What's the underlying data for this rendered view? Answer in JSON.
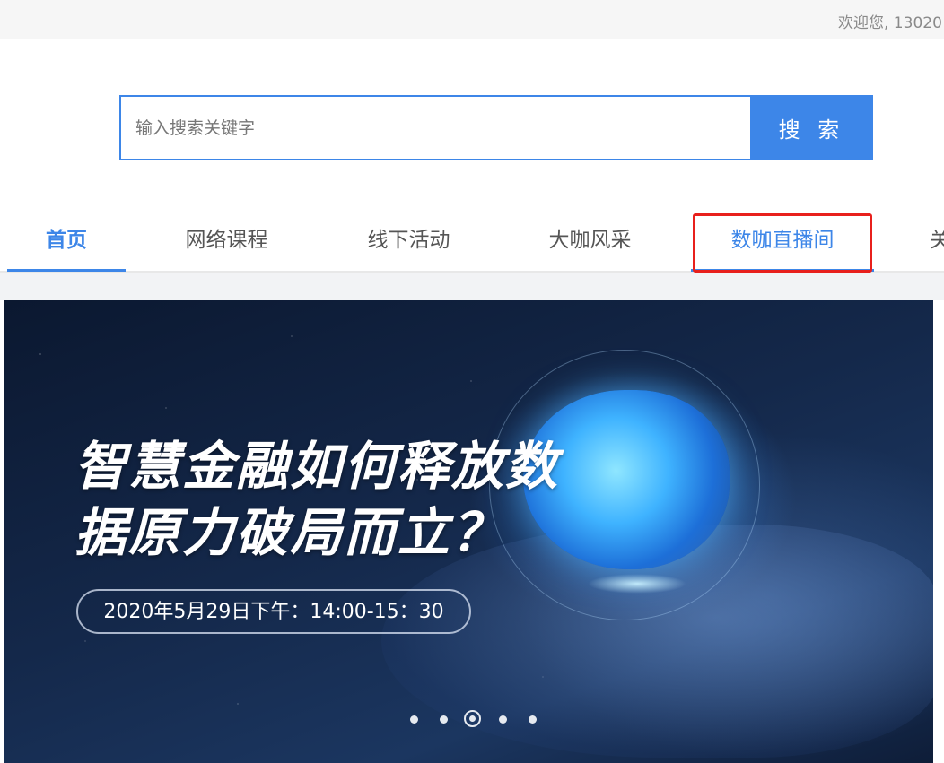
{
  "topbar": {
    "welcome": "欢迎您, 13020"
  },
  "search": {
    "placeholder": "输入搜索关键字",
    "value": "",
    "button_label": "搜 索"
  },
  "nav": {
    "items": [
      {
        "label": "首页"
      },
      {
        "label": "网络课程"
      },
      {
        "label": "线下活动"
      },
      {
        "label": "大咖风采"
      },
      {
        "label": "数咖直播间"
      },
      {
        "label": "关"
      }
    ]
  },
  "colors": {
    "accent": "#3d86e8",
    "highlight_border": "#e8201c"
  },
  "banner": {
    "headline_line1": "智慧金融如何释放数",
    "headline_line2": "据原力破局而立？",
    "date": "2020年5月29日下午：14:00-15：30",
    "carousel": {
      "count": 5,
      "active_index": 3
    }
  }
}
